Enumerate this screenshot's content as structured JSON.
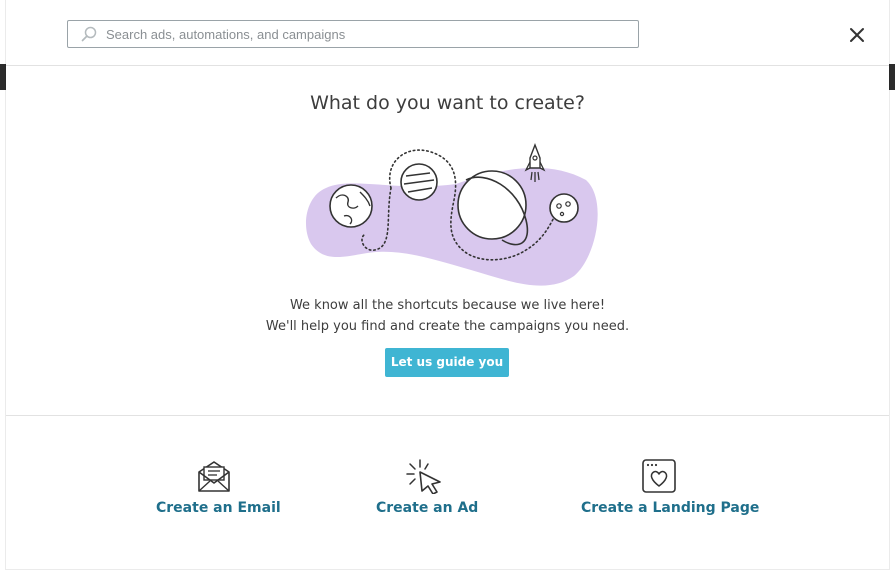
{
  "search": {
    "placeholder": "Search ads, automations, and campaigns",
    "value": ""
  },
  "dialog": {
    "title": "What do you want to create?",
    "desc_line1": "We know all the shortcuts because we live here!",
    "desc_line2": "We'll help you find and create the campaigns you need.",
    "guide_button": "Let us guide you"
  },
  "options": [
    {
      "label": "Create an Email",
      "icon": "envelope-icon"
    },
    {
      "label": "Create an Ad",
      "icon": "cursor-click-icon"
    },
    {
      "label": "Create a Landing Page",
      "icon": "landing-page-heart-icon"
    }
  ],
  "colors": {
    "accent": "#3fb5d3",
    "link": "#1f6f8b",
    "blob": "#d9c8ee"
  }
}
